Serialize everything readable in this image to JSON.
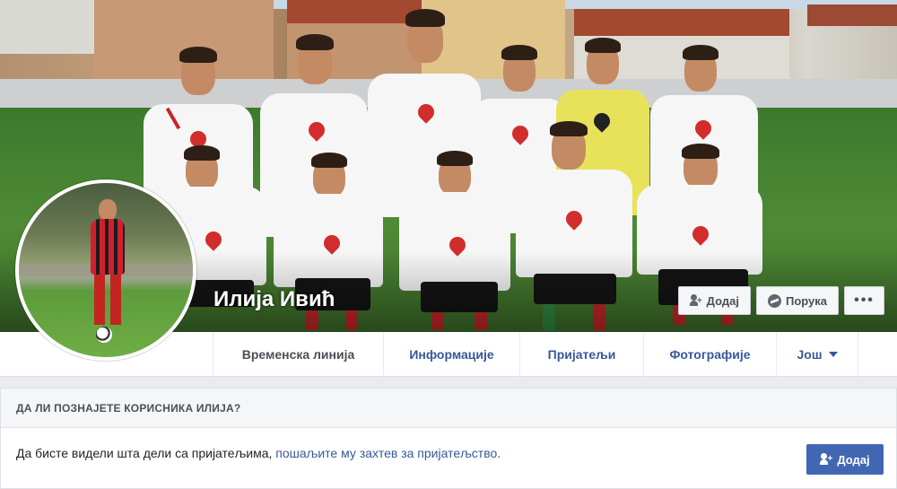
{
  "profile": {
    "name": "Илија Ивић"
  },
  "cover_actions": {
    "add_label": "Додај",
    "message_label": "Порука",
    "more_label": "•••"
  },
  "tabs": [
    {
      "label": "Временска линија",
      "active": true
    },
    {
      "label": "Информације",
      "active": false
    },
    {
      "label": "Пријатељи",
      "active": false
    },
    {
      "label": "Фотографије",
      "active": false
    },
    {
      "label": "Још",
      "active": false
    }
  ],
  "friend_card": {
    "title": "ДА ЛИ ПОЗНАЈЕТЕ КОРИСНИКА ИЛИЈА?",
    "text": "Да бисте видели шта дели са пријатељима,",
    "link_text": "пошаљите му захтев за пријатељство.",
    "add_button_label": "Додај"
  },
  "colors": {
    "link": "#365899",
    "primary_button": "#4267b2",
    "background": "#e9ebee"
  },
  "icons": {
    "add_friend": "add-friend-icon",
    "messenger": "messenger-icon",
    "more": "more-dots-icon",
    "dropdown": "caret-down-icon"
  }
}
